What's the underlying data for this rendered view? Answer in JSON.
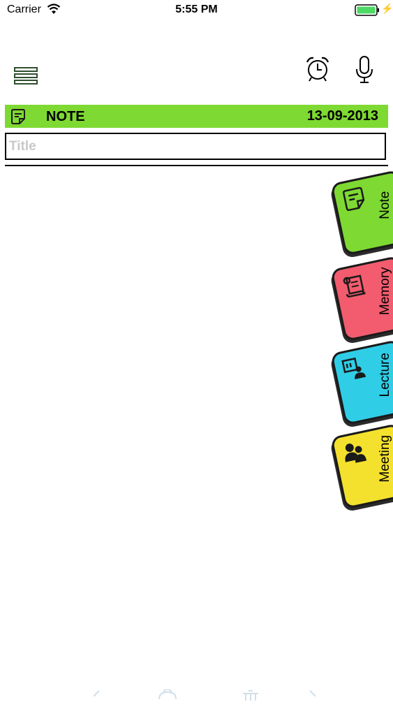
{
  "status_bar": {
    "carrier": "Carrier",
    "time": "5:55 PM"
  },
  "header": {
    "menu_icon": "menu-icon",
    "alarm_icon": "alarm-clock-icon",
    "mic_icon": "microphone-icon"
  },
  "note_bar": {
    "label": "NOTE",
    "date": "13-09-2013",
    "color": "#7ed932"
  },
  "title_field": {
    "placeholder": "Title",
    "value": ""
  },
  "category_tabs": [
    {
      "label": "Note",
      "color": "#7ed932",
      "icon": "note-icon"
    },
    {
      "label": "Memory",
      "color": "#f25c6e",
      "icon": "scroll-icon"
    },
    {
      "label": "Lecture",
      "color": "#30cde6",
      "icon": "lecture-icon"
    },
    {
      "label": "Meeting",
      "color": "#f4e12e",
      "icon": "meeting-icon"
    }
  ],
  "bottom_toolbar": {
    "icons": [
      "back-icon",
      "basket-icon",
      "trash-icon",
      "forward-icon"
    ]
  }
}
